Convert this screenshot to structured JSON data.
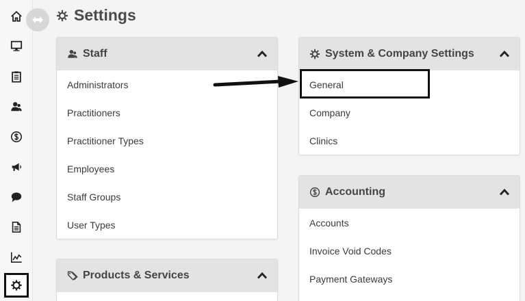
{
  "page": {
    "title": "Settings"
  },
  "rail": {
    "items": [
      {
        "icon": "home-icon"
      },
      {
        "icon": "monitor-icon"
      },
      {
        "icon": "clipboard-icon"
      },
      {
        "icon": "users-icon"
      },
      {
        "icon": "dollar-circle-icon"
      },
      {
        "icon": "megaphone-icon"
      },
      {
        "icon": "chat-bubble-icon"
      },
      {
        "icon": "document-icon"
      },
      {
        "icon": "line-chart-icon"
      },
      {
        "icon": "gear-icon",
        "active": true
      }
    ]
  },
  "staff": {
    "title": "Staff",
    "items": [
      "Administrators",
      "Practitioners",
      "Practitioner Types",
      "Employees",
      "Staff Groups",
      "User Types"
    ]
  },
  "products": {
    "title": "Products & Services"
  },
  "system": {
    "title": "System & Company Settings",
    "items": [
      "General",
      "Company",
      "Clinics"
    ]
  },
  "accounting": {
    "title": "Accounting",
    "items": [
      "Accounts",
      "Invoice Void Codes",
      "Payment Gateways"
    ]
  },
  "colors": {
    "header_bg": "#e3e3e3",
    "highlight_border": "#111111"
  }
}
